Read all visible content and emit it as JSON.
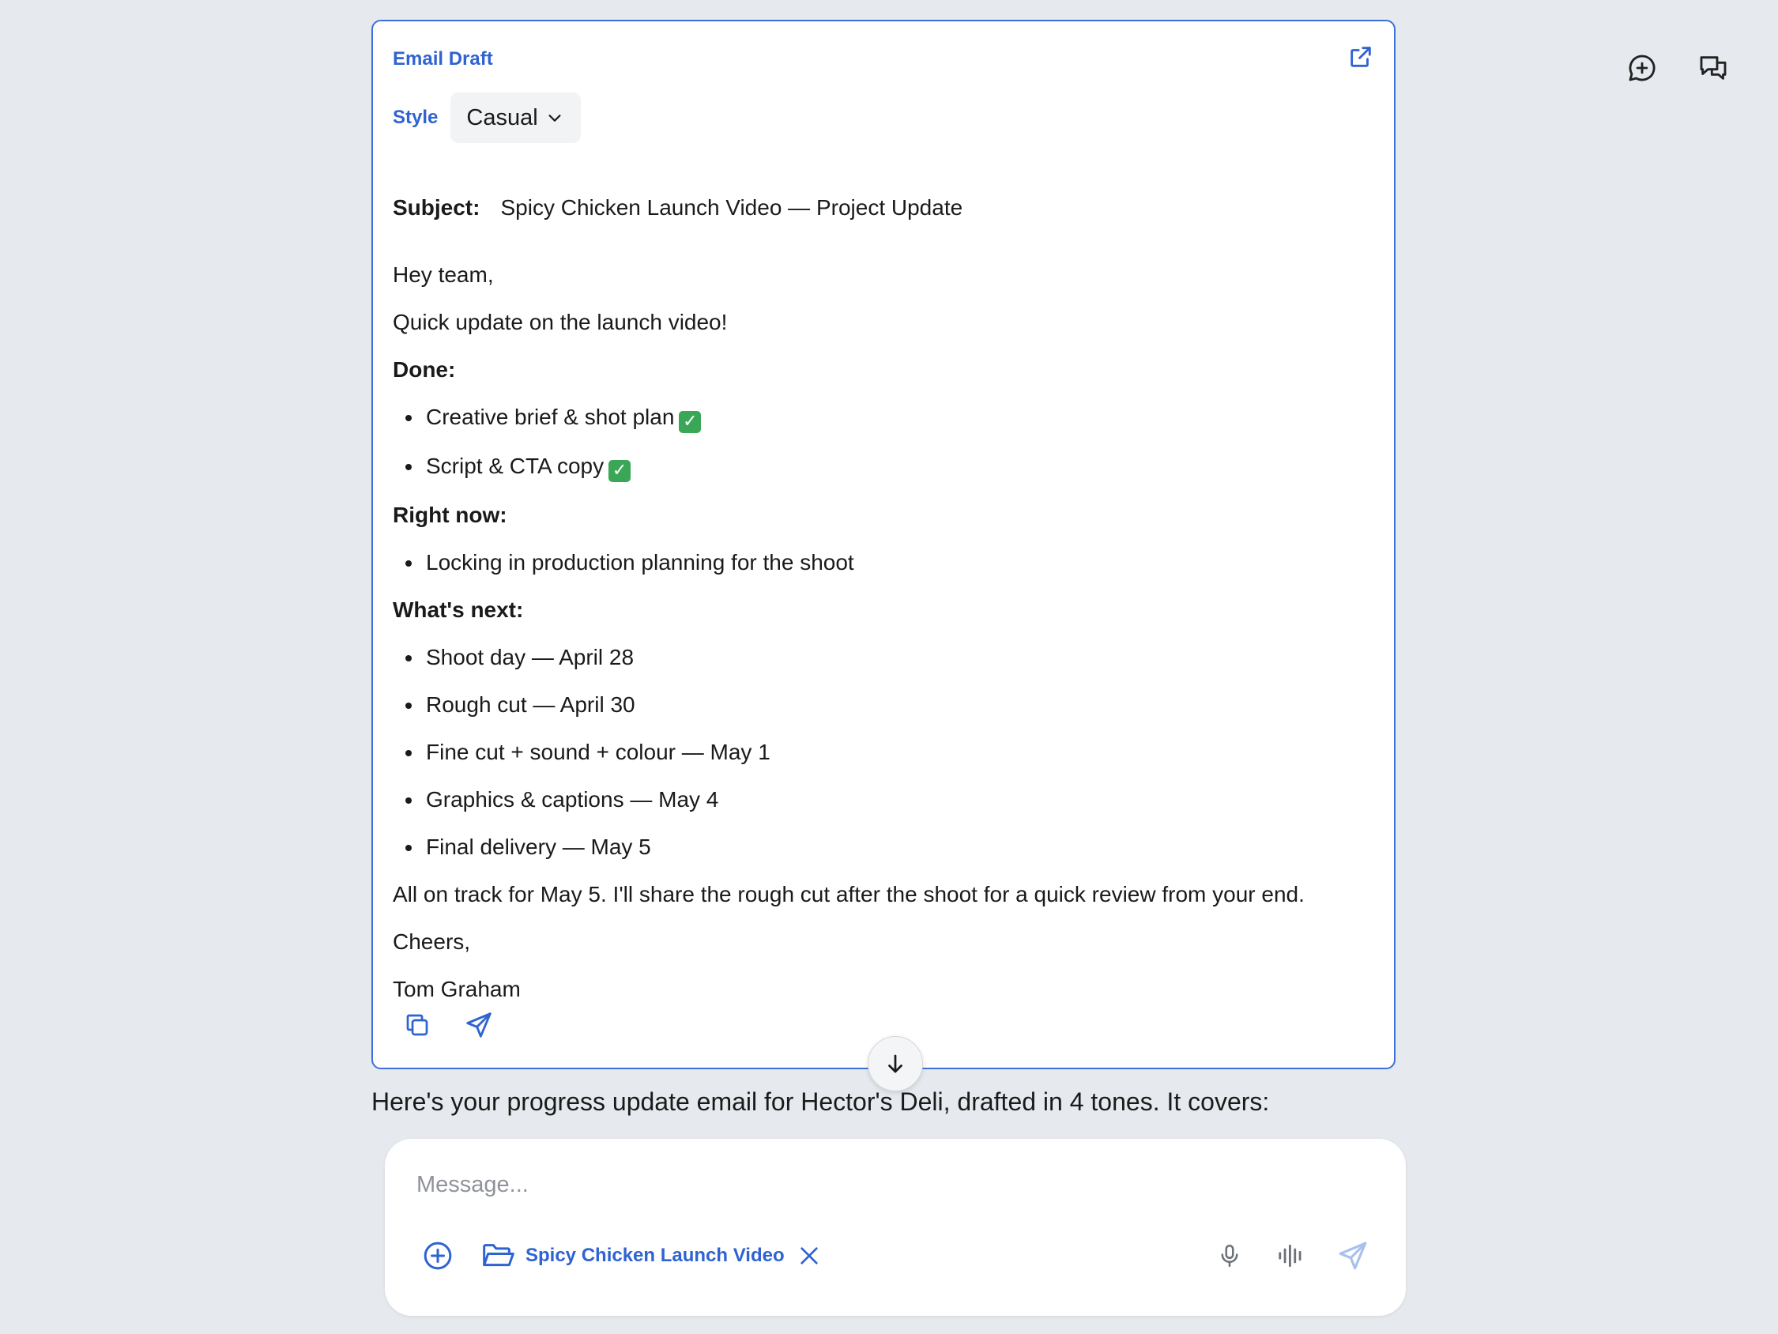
{
  "toolbar": {
    "icons": [
      "chat-plus-icon",
      "chats-icon"
    ]
  },
  "email_card": {
    "title": "Email Draft",
    "style_label": "Style",
    "style_value": "Casual",
    "subject_label": "Subject:",
    "subject": "Spicy Chicken Launch Video — Project Update",
    "greeting": "Hey team,",
    "intro": "Quick update on the launch video!",
    "done_heading": "Done:",
    "done_items": [
      "Creative brief & shot plan",
      "Script & CTA copy"
    ],
    "right_now_heading": "Right now:",
    "right_now_items": [
      "Locking in production planning for the shoot"
    ],
    "next_heading": "What's next:",
    "next_items": [
      "Shoot day — April 28",
      "Rough cut — April 30",
      "Fine cut + sound + colour — May 1",
      "Graphics & captions — May 4",
      "Final delivery — May 5"
    ],
    "closing": "All on track for May 5. I'll share the rough cut after the shoot for a quick review from your end.",
    "signoff": "Cheers,",
    "signature": "Tom Graham",
    "accent_color": "#2f63d1"
  },
  "summary": "Here's your progress update email for Hector's Deli, drafted in 4 tones. It covers:",
  "composer": {
    "placeholder": "Message...",
    "project_label": "Spicy Chicken Launch Video"
  }
}
